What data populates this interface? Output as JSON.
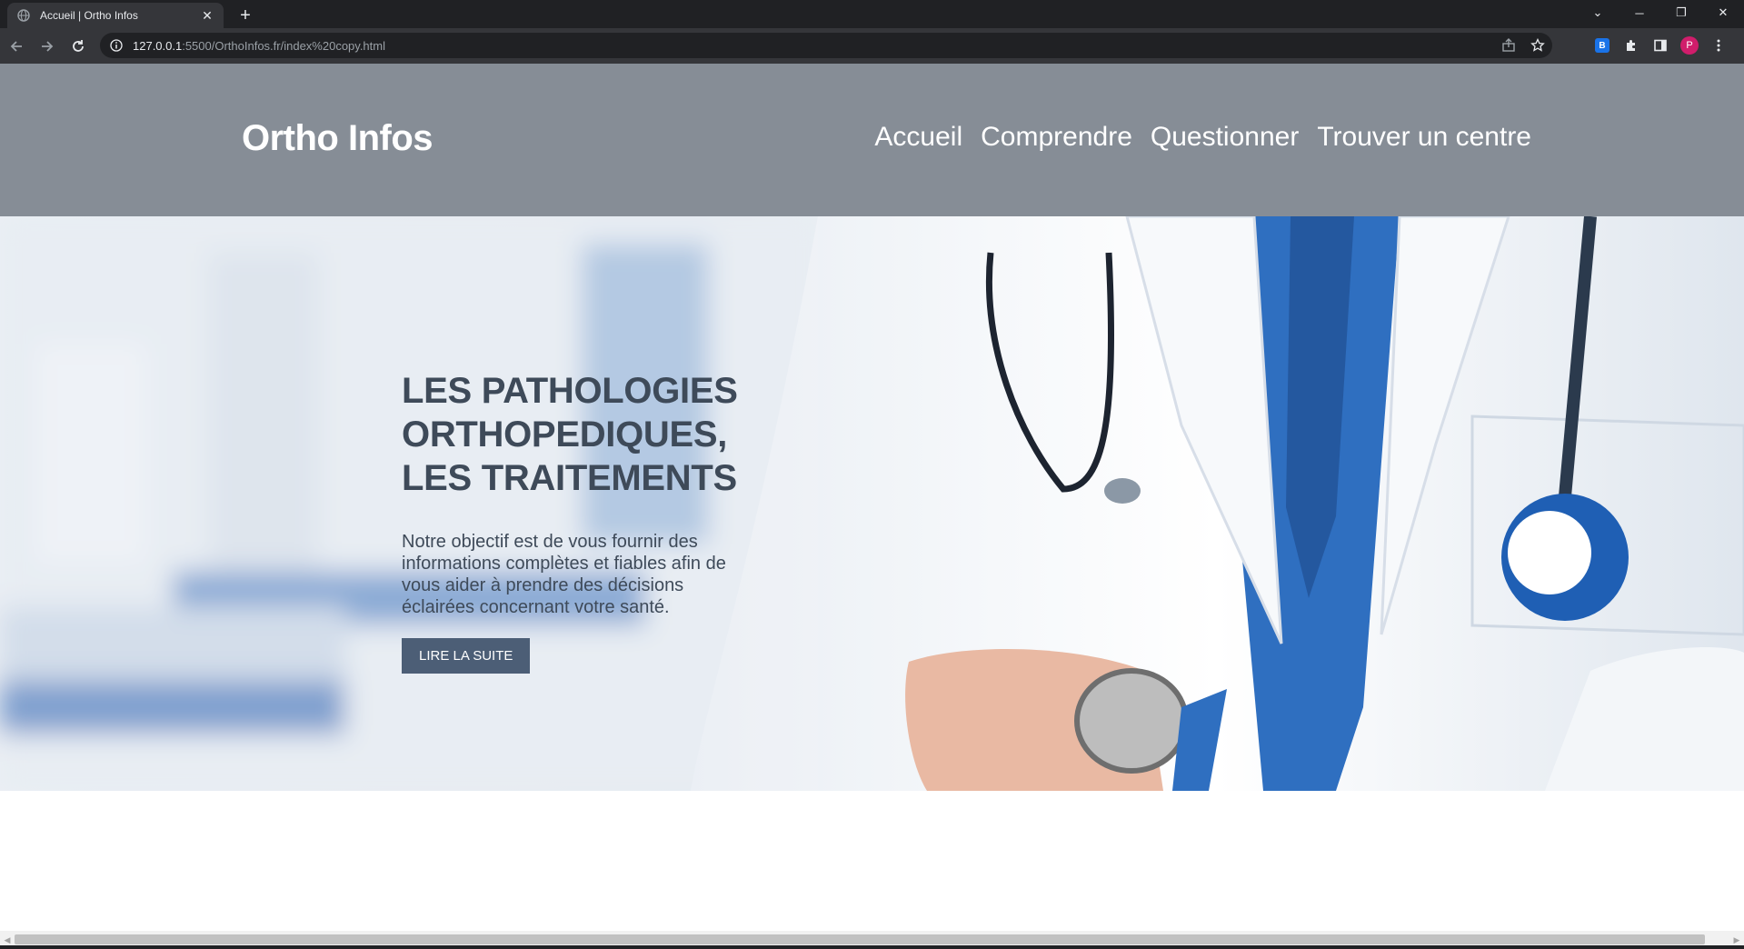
{
  "browser": {
    "tab_title": "Accueil | Ortho Infos",
    "url_host": "127.0.0.1",
    "url_rest": ":5500/OrthoInfos.fr/index%20copy.html",
    "profile_initial": "P",
    "extension_label": "B"
  },
  "header": {
    "logo": "Ortho Infos",
    "nav": [
      "Accueil",
      "Comprendre",
      "Questionner",
      "Trouver un centre"
    ]
  },
  "hero": {
    "title_lines": [
      "LES PATHOLOGIES",
      "ORTHOPEDIQUES,",
      "LES TRAITEMENTS"
    ],
    "text": "Notre objectif est de vous fournir des informations complètes et fiables afin de vous aider à prendre des décisions éclairées concernant votre santé.",
    "cta": "LIRE LA SUITE"
  },
  "colors": {
    "header_bg": "#868d96",
    "text_dark": "#3e4a59",
    "button_bg": "#4c5e76",
    "coat_blue": "#2f6fc0"
  }
}
